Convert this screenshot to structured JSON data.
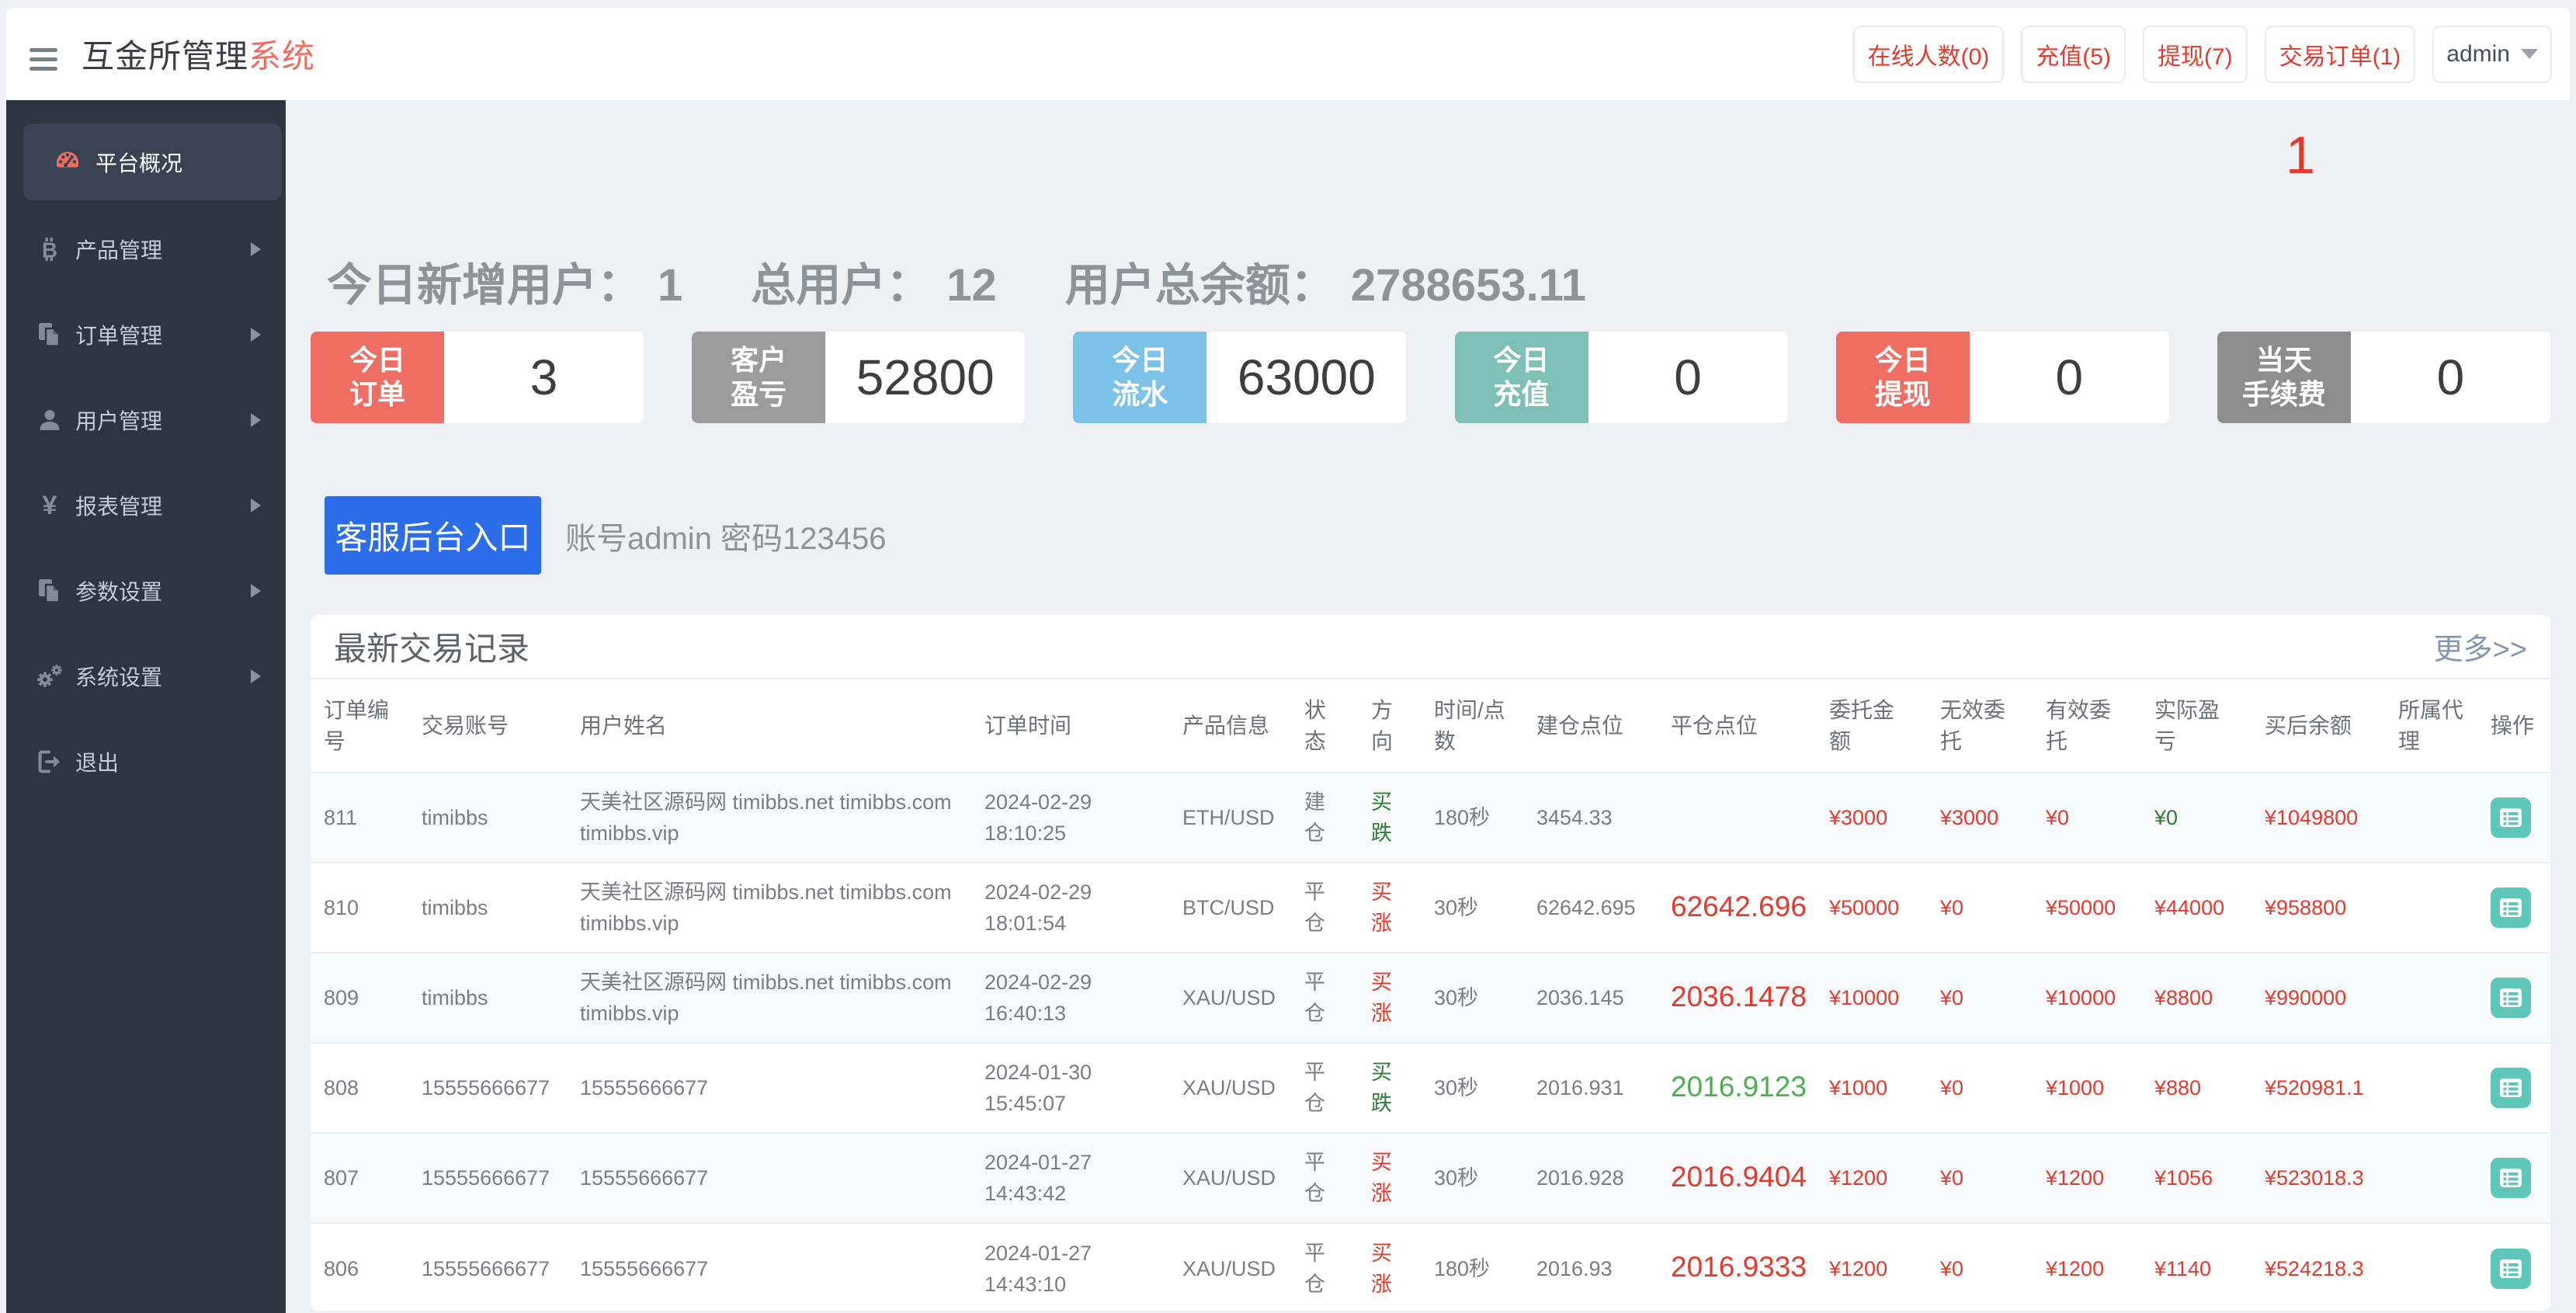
{
  "app": {
    "title_main": "互金所管理",
    "title_accent": "系统"
  },
  "header": {
    "stat_buttons": [
      {
        "label": "在线人数(0)"
      },
      {
        "label": "充值(5)"
      },
      {
        "label": "提现(7)"
      },
      {
        "label": "交易订单(1)"
      }
    ],
    "user": {
      "name": "admin"
    }
  },
  "sidebar": {
    "items": [
      {
        "label": "平台概况",
        "icon": "gauge-icon",
        "active": true,
        "has_submenu": false
      },
      {
        "label": "产品管理",
        "icon": "bitcoin-icon",
        "active": false,
        "has_submenu": true
      },
      {
        "label": "订单管理",
        "icon": "files-icon",
        "active": false,
        "has_submenu": true
      },
      {
        "label": "用户管理",
        "icon": "user-icon",
        "active": false,
        "has_submenu": true
      },
      {
        "label": "报表管理",
        "icon": "yen-icon",
        "active": false,
        "has_submenu": true
      },
      {
        "label": "参数设置",
        "icon": "files-icon",
        "active": false,
        "has_submenu": true
      },
      {
        "label": "系统设置",
        "icon": "gears-icon",
        "active": false,
        "has_submenu": true
      },
      {
        "label": "退出",
        "icon": "signout-icon",
        "active": false,
        "has_submenu": false
      }
    ]
  },
  "overview": {
    "stats": [
      {
        "label": "今日新增用户：",
        "value": "1"
      },
      {
        "label": "总用户：",
        "value": "12"
      },
      {
        "label": "用户总余额：",
        "value": "2788653.11"
      }
    ],
    "cards": [
      {
        "label": "今日\n订单",
        "value": "3",
        "color": "#ee6e63"
      },
      {
        "label": "客户\n盈亏",
        "value": "52800",
        "color": "#9c9c9c"
      },
      {
        "label": "今日\n流水",
        "value": "63000",
        "color": "#7dc2e9"
      },
      {
        "label": "今日\n充值",
        "value": "0",
        "color": "#7dc0b5"
      },
      {
        "label": "今日\n提现",
        "value": "0",
        "color": "#ee6e63"
      },
      {
        "label": "当天\n手续费",
        "value": "0",
        "color": "#8d8d8d"
      }
    ],
    "service_button": "客服后台入口",
    "service_note": "账号admin 密码123456",
    "floating_badge": "1"
  },
  "panel": {
    "title": "最新交易记录",
    "more_link": "更多>>",
    "columns": [
      "订单编号",
      "交易账号",
      "用户姓名",
      "订单时间",
      "产品信息",
      "状态",
      "方向",
      "时间/点数",
      "建仓点位",
      "平仓点位",
      "委托金额",
      "无效委托",
      "有效委托",
      "实际盈亏",
      "买后余额",
      "所属代理",
      "操作"
    ],
    "rows": [
      {
        "id": "811",
        "account": "timibbs",
        "name": "天美社区源码网 timibbs.net timibbs.com timibbs.vip",
        "time": "2024-02-29 18:10:25",
        "product": "ETH/USD",
        "status": "建仓",
        "direction": "买跌",
        "direction_color": "green",
        "duration": "180秒",
        "open_point": "3454.33",
        "close_point": "",
        "close_color": "red",
        "amount": "¥3000",
        "invalid": "¥3000",
        "valid": "¥0",
        "profit": "¥0",
        "profit_color": "green",
        "balance": "¥1049800",
        "agent": ""
      },
      {
        "id": "810",
        "account": "timibbs",
        "name": "天美社区源码网 timibbs.net timibbs.com timibbs.vip",
        "time": "2024-02-29 18:01:54",
        "product": "BTC/USD",
        "status": "平仓",
        "direction": "买涨",
        "direction_color": "red",
        "duration": "30秒",
        "open_point": "62642.695",
        "close_point": "62642.696",
        "close_color": "red",
        "amount": "¥50000",
        "invalid": "¥0",
        "valid": "¥50000",
        "profit": "¥44000",
        "profit_color": "red",
        "balance": "¥958800",
        "agent": ""
      },
      {
        "id": "809",
        "account": "timibbs",
        "name": "天美社区源码网 timibbs.net timibbs.com timibbs.vip",
        "time": "2024-02-29 16:40:13",
        "product": "XAU/USD",
        "status": "平仓",
        "direction": "买涨",
        "direction_color": "red",
        "duration": "30秒",
        "open_point": "2036.145",
        "close_point": "2036.1478",
        "close_color": "red",
        "amount": "¥10000",
        "invalid": "¥0",
        "valid": "¥10000",
        "profit": "¥8800",
        "profit_color": "red",
        "balance": "¥990000",
        "agent": ""
      },
      {
        "id": "808",
        "account": "15555666677",
        "name": "15555666677",
        "time": "2024-01-30 15:45:07",
        "product": "XAU/USD",
        "status": "平仓",
        "direction": "买跌",
        "direction_color": "green",
        "duration": "30秒",
        "open_point": "2016.931",
        "close_point": "2016.9123",
        "close_color": "green",
        "amount": "¥1000",
        "invalid": "¥0",
        "valid": "¥1000",
        "profit": "¥880",
        "profit_color": "red",
        "balance": "¥520981.1",
        "agent": ""
      },
      {
        "id": "807",
        "account": "15555666677",
        "name": "15555666677",
        "time": "2024-01-27 14:43:42",
        "product": "XAU/USD",
        "status": "平仓",
        "direction": "买涨",
        "direction_color": "red",
        "duration": "30秒",
        "open_point": "2016.928",
        "close_point": "2016.9404",
        "close_color": "red",
        "amount": "¥1200",
        "invalid": "¥0",
        "valid": "¥1200",
        "profit": "¥1056",
        "profit_color": "red",
        "balance": "¥523018.3",
        "agent": ""
      },
      {
        "id": "806",
        "account": "15555666677",
        "name": "15555666677",
        "time": "2024-01-27 14:43:10",
        "product": "XAU/USD",
        "status": "平仓",
        "direction": "买涨",
        "direction_color": "red",
        "duration": "180秒",
        "open_point": "2016.93",
        "close_point": "2016.9333",
        "close_color": "red",
        "amount": "¥1200",
        "invalid": "¥0",
        "valid": "¥1200",
        "profit": "¥1140",
        "profit_color": "red",
        "balance": "¥524218.3",
        "agent": ""
      }
    ]
  }
}
